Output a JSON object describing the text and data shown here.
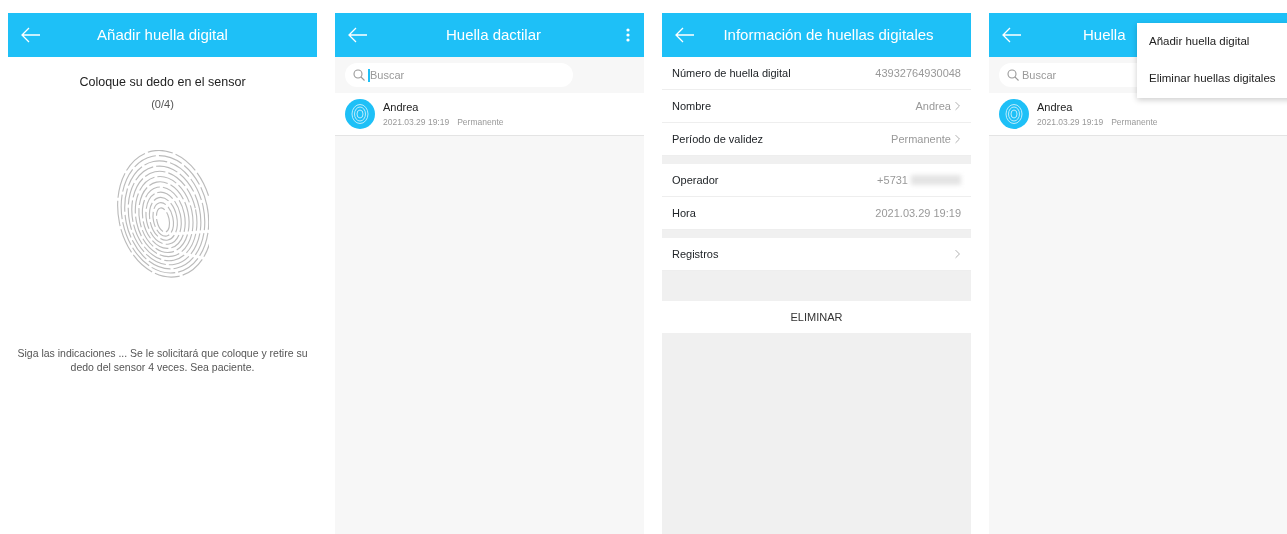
{
  "screens": [
    {
      "kind": "enroll",
      "title": "Añadir huella digital",
      "prompt": "Coloque su dedo en el sensor",
      "progress": "(0/4)",
      "instructions": "Siga las indicaciones ... Se le solicitará que coloque y retire su dedo del sensor 4 veces. Sea paciente."
    },
    {
      "kind": "list",
      "title": "Huella dactilar",
      "search": {
        "placeholder": "Buscar",
        "focused": true
      },
      "items": [
        {
          "name": "Andrea",
          "date": "2021.03.29 19:19",
          "validity": "Permanente"
        }
      ]
    },
    {
      "kind": "detail",
      "title": "Información de huellas digitales",
      "groups": [
        [
          {
            "label": "Número de huella digital",
            "value": "43932764930048",
            "chevron": false,
            "redacted": false
          },
          {
            "label": "Nombre",
            "value": "Andrea",
            "chevron": true,
            "redacted": false
          },
          {
            "label": "Período de validez",
            "value": "Permanente",
            "chevron": true,
            "redacted": false
          }
        ],
        [
          {
            "label": "Operador",
            "value": "+5731",
            "chevron": false,
            "redacted": true
          },
          {
            "label": "Hora",
            "value": "2021.03.29 19:19",
            "chevron": false,
            "redacted": false
          }
        ],
        [
          {
            "label": "Registros",
            "chevron": true,
            "redacted": false
          }
        ]
      ],
      "action": "ELIMINAR"
    },
    {
      "kind": "list",
      "title": "Huella",
      "search": {
        "placeholder": "Buscar",
        "focused": false
      },
      "items": [
        {
          "name": "Andrea",
          "date": "2021.03.29 19:19",
          "validity": "Permanente"
        }
      ],
      "menu": [
        "Añadir huella digital",
        "Eliminar huellas digitales"
      ]
    }
  ]
}
